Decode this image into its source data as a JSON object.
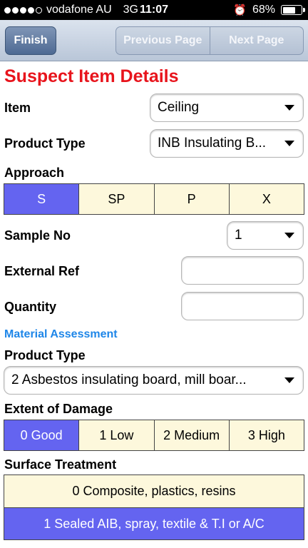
{
  "status_bar": {
    "carrier": "vodafone AU",
    "network": "3G",
    "time": "11:07",
    "battery": "68%",
    "battery_level": 0.68
  },
  "toolbar": {
    "finish_label": "Finish",
    "previous_label": "Previous Page",
    "next_label": "Next Page"
  },
  "page_title": "Suspect Item Details",
  "fields": {
    "item": {
      "label": "Item",
      "value": "Ceiling"
    },
    "product_type": {
      "label": "Product Type",
      "value": "INB Insulating B..."
    },
    "approach": {
      "label": "Approach",
      "options": [
        "S",
        "SP",
        "P",
        "X"
      ],
      "selected": "S"
    },
    "sample_no": {
      "label": "Sample No",
      "value": "1"
    },
    "external_ref": {
      "label": "External Ref",
      "value": ""
    },
    "quantity": {
      "label": "Quantity",
      "value": ""
    }
  },
  "material_assessment": {
    "section_label": "Material Assessment",
    "product_type": {
      "label": "Product Type",
      "value": "2 Asbestos insulating board, mill boar..."
    },
    "extent_of_damage": {
      "label": "Extent of Damage",
      "options": [
        "0 Good",
        "1 Low",
        "2 Medium",
        "3 High"
      ],
      "selected": "0 Good"
    },
    "surface_treatment": {
      "label": "Surface Treatment",
      "options": [
        "0 Composite, plastics, resins",
        "1 Sealed AIB, spray, textile & T.I or A/C"
      ],
      "selected": "1 Sealed AIB, spray, textile & T.I or A/C"
    }
  },
  "colors": {
    "title": "#e8141c",
    "section": "#1e86e8",
    "selected": "#6464f0",
    "option_bg": "#fdf8dc"
  }
}
